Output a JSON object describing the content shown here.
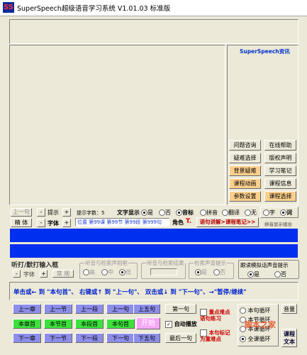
{
  "window": {
    "title": "SuperSpeech超级语音学习系统 V1.01.03  标准版",
    "logo": "SS"
  },
  "side": {
    "title": "SuperSpeech资讯",
    "buttons": [
      {
        "label": "问题咨询",
        "style": ""
      },
      {
        "label": "在线帮助",
        "style": ""
      },
      {
        "label": "疑难选择",
        "style": ""
      },
      {
        "label": "版权声明",
        "style": ""
      },
      {
        "label": "背景疑难",
        "style": "orange"
      },
      {
        "label": "学习笔记",
        "style": ""
      },
      {
        "label": "课程动画",
        "style": "orange"
      },
      {
        "label": "课程信息",
        "style": ""
      },
      {
        "label": "参数设置",
        "style": "orange"
      },
      {
        "label": "课程选择",
        "style": "orange"
      }
    ]
  },
  "controls": {
    "prev_sentence": "上一句",
    "next_sentence": "下一句",
    "prompt_label": "提示",
    "minus": "-",
    "plus": "+",
    "prompt_count": "提示字数：5",
    "text_display": "文字显示",
    "yes": "是",
    "no": "否",
    "phonetic": "音标",
    "pinyin": "拼音",
    "translate": "翻译",
    "none": "无",
    "char": "字",
    "word": "词",
    "accuracy": "精 体",
    "font_label": "字体",
    "position_text": "位置 第99课 第99节 第99段 第999句",
    "role_label": "角色",
    "role_icon": "T.",
    "explain_btn": "语句讲解>课程笔记>>",
    "pinyin_combo": "拼音显示组合"
  },
  "mid": {
    "type_group": "听打/默打输入框",
    "font": "字体",
    "normal": "常 规",
    "match_group": "听音与检索声相框",
    "high": "高",
    "middle": "中",
    "low": "低",
    "result_group": "听音与检索结果",
    "prompt_group": "检索声音提示",
    "follow_group": "跟读模拟话声音提示"
  },
  "hint": "单击或← 到 \"本句首\"、 右键或↑ 到 \"上一句\"、 双击或↓ 到 \"下一句\"、→\"暂停/继续\"",
  "nav": {
    "row1": [
      "上一章",
      "上一节",
      "上一段",
      "上一句",
      "上五句",
      "第一句"
    ],
    "row2": [
      "本章首",
      "本节首",
      "本段首",
      "本句首",
      "开始"
    ],
    "auto_play": "自动播放",
    "row3": [
      "下一章",
      "下一节",
      "下一段",
      "下一句",
      "下五句",
      "最后一句"
    ],
    "focus_practice": "重点难点\n语句练习",
    "mark_practice": "本句标记\n为重难点",
    "loop_options": [
      "本句循环",
      "本节循环",
      "本课循环",
      "全课循环"
    ],
    "volume": "音量",
    "lesson_text": "课程\n文本"
  },
  "watermark": "脚本之家"
}
